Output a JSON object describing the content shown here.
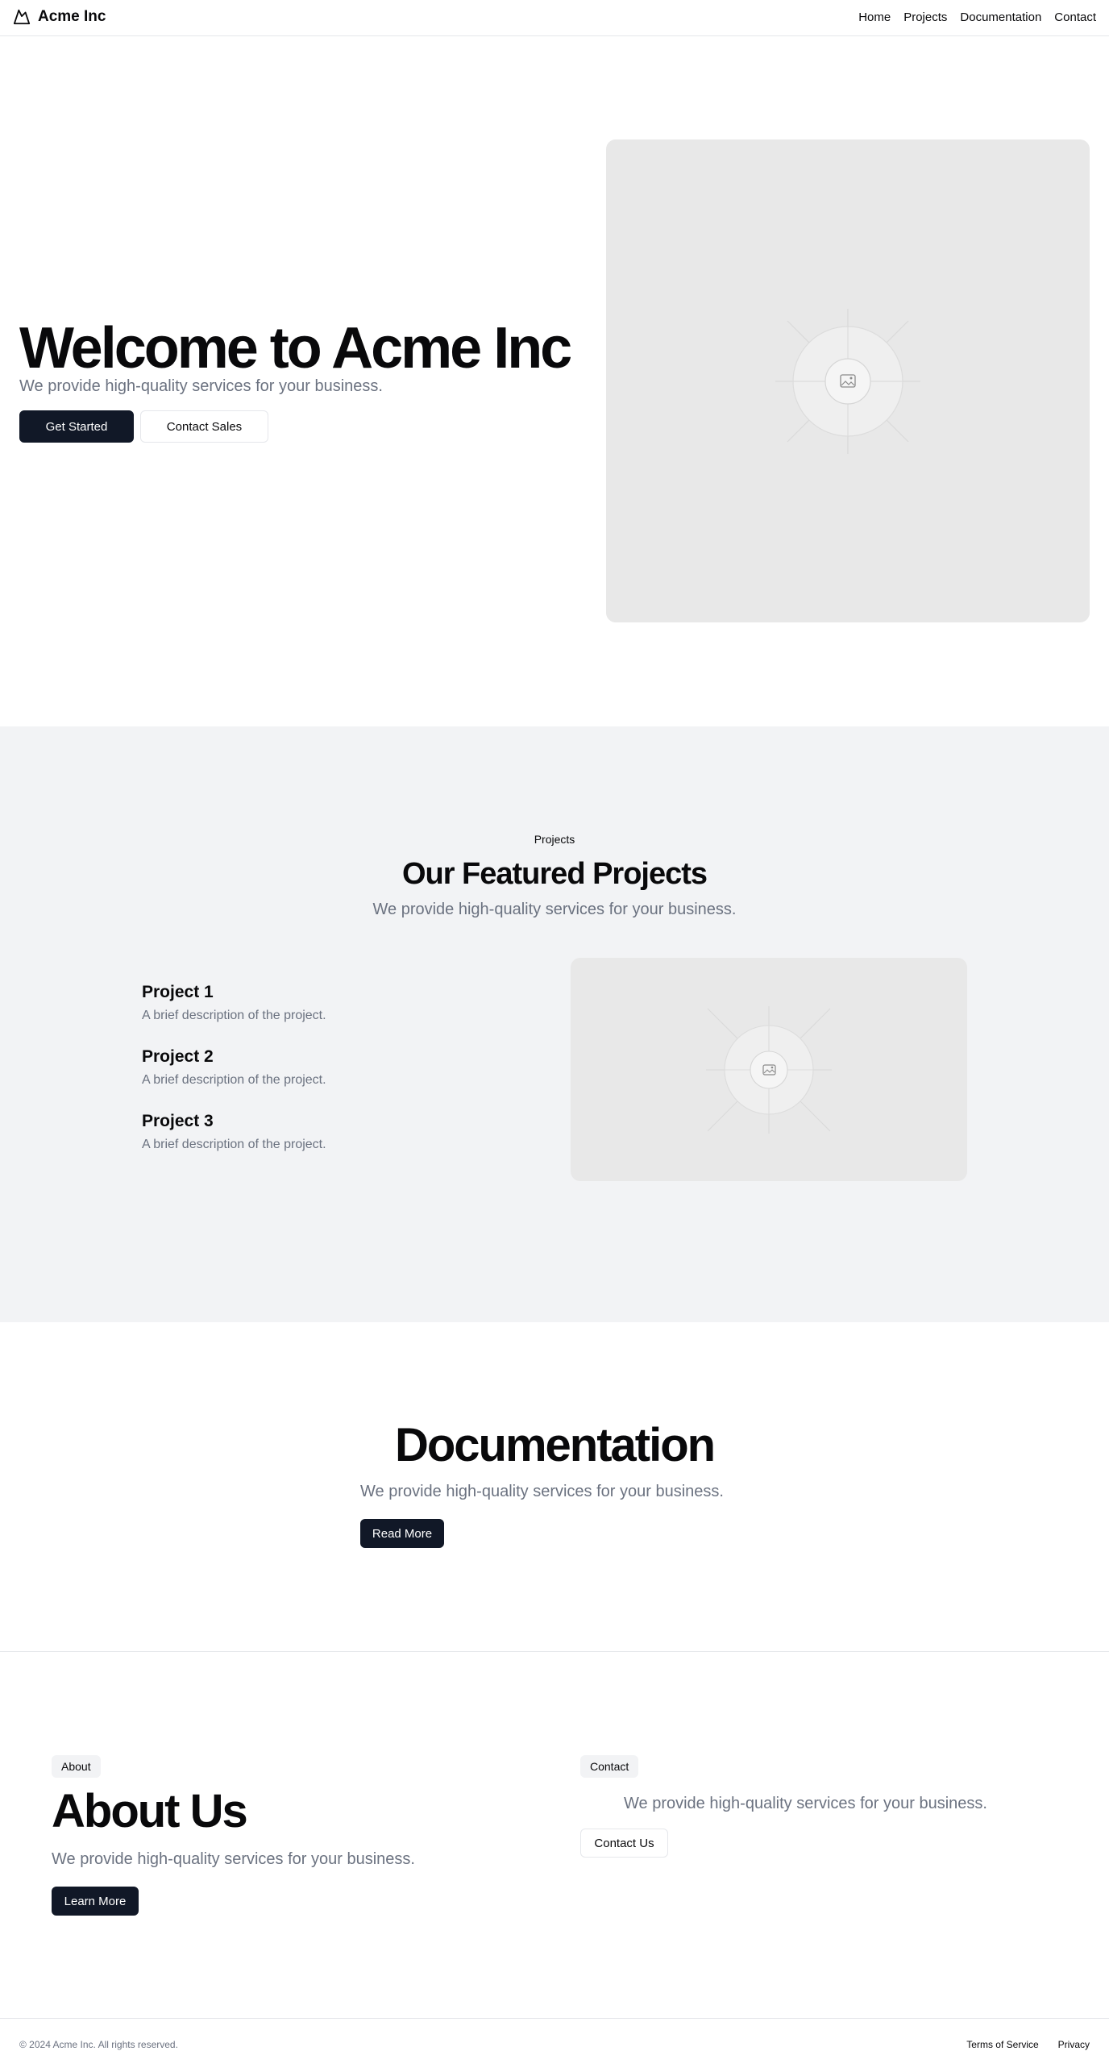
{
  "header": {
    "brand": "Acme Inc",
    "logo_icon": "mountain-icon",
    "nav": [
      "Home",
      "Projects",
      "Documentation",
      "Contact"
    ]
  },
  "hero": {
    "title": "Welcome to Acme Inc",
    "subtitle": "We provide high-quality services for your business.",
    "primary_button": "Get Started",
    "secondary_button": "Contact Sales",
    "image_icon": "image-placeholder-icon"
  },
  "projects": {
    "eyebrow": "Projects",
    "title": "Our Featured Projects",
    "subtitle": "We provide high-quality services for your business.",
    "items": [
      {
        "title": "Project 1",
        "description": "A brief description of the project."
      },
      {
        "title": "Project 2",
        "description": "A brief description of the project."
      },
      {
        "title": "Project 3",
        "description": "A brief description of the project."
      }
    ],
    "image_icon": "image-placeholder-icon"
  },
  "documentation": {
    "title": "Documentation",
    "subtitle": "We provide high-quality services for your business.",
    "button": "Read More"
  },
  "about": {
    "badge": "About",
    "title": "About Us",
    "subtitle": "We provide high-quality services for your business.",
    "button": "Learn More"
  },
  "contact": {
    "badge": "Contact",
    "subtitle": "We provide high-quality services for your business.",
    "button": "Contact Us"
  },
  "footer": {
    "copyright": "© 2024 Acme Inc. All rights reserved.",
    "links": [
      "Terms of Service",
      "Privacy"
    ]
  },
  "colors": {
    "primary_button_bg": "#111827",
    "muted_text": "#6b7280",
    "section_bg": "#f2f3f5",
    "placeholder_bg": "#e8e8e8"
  }
}
